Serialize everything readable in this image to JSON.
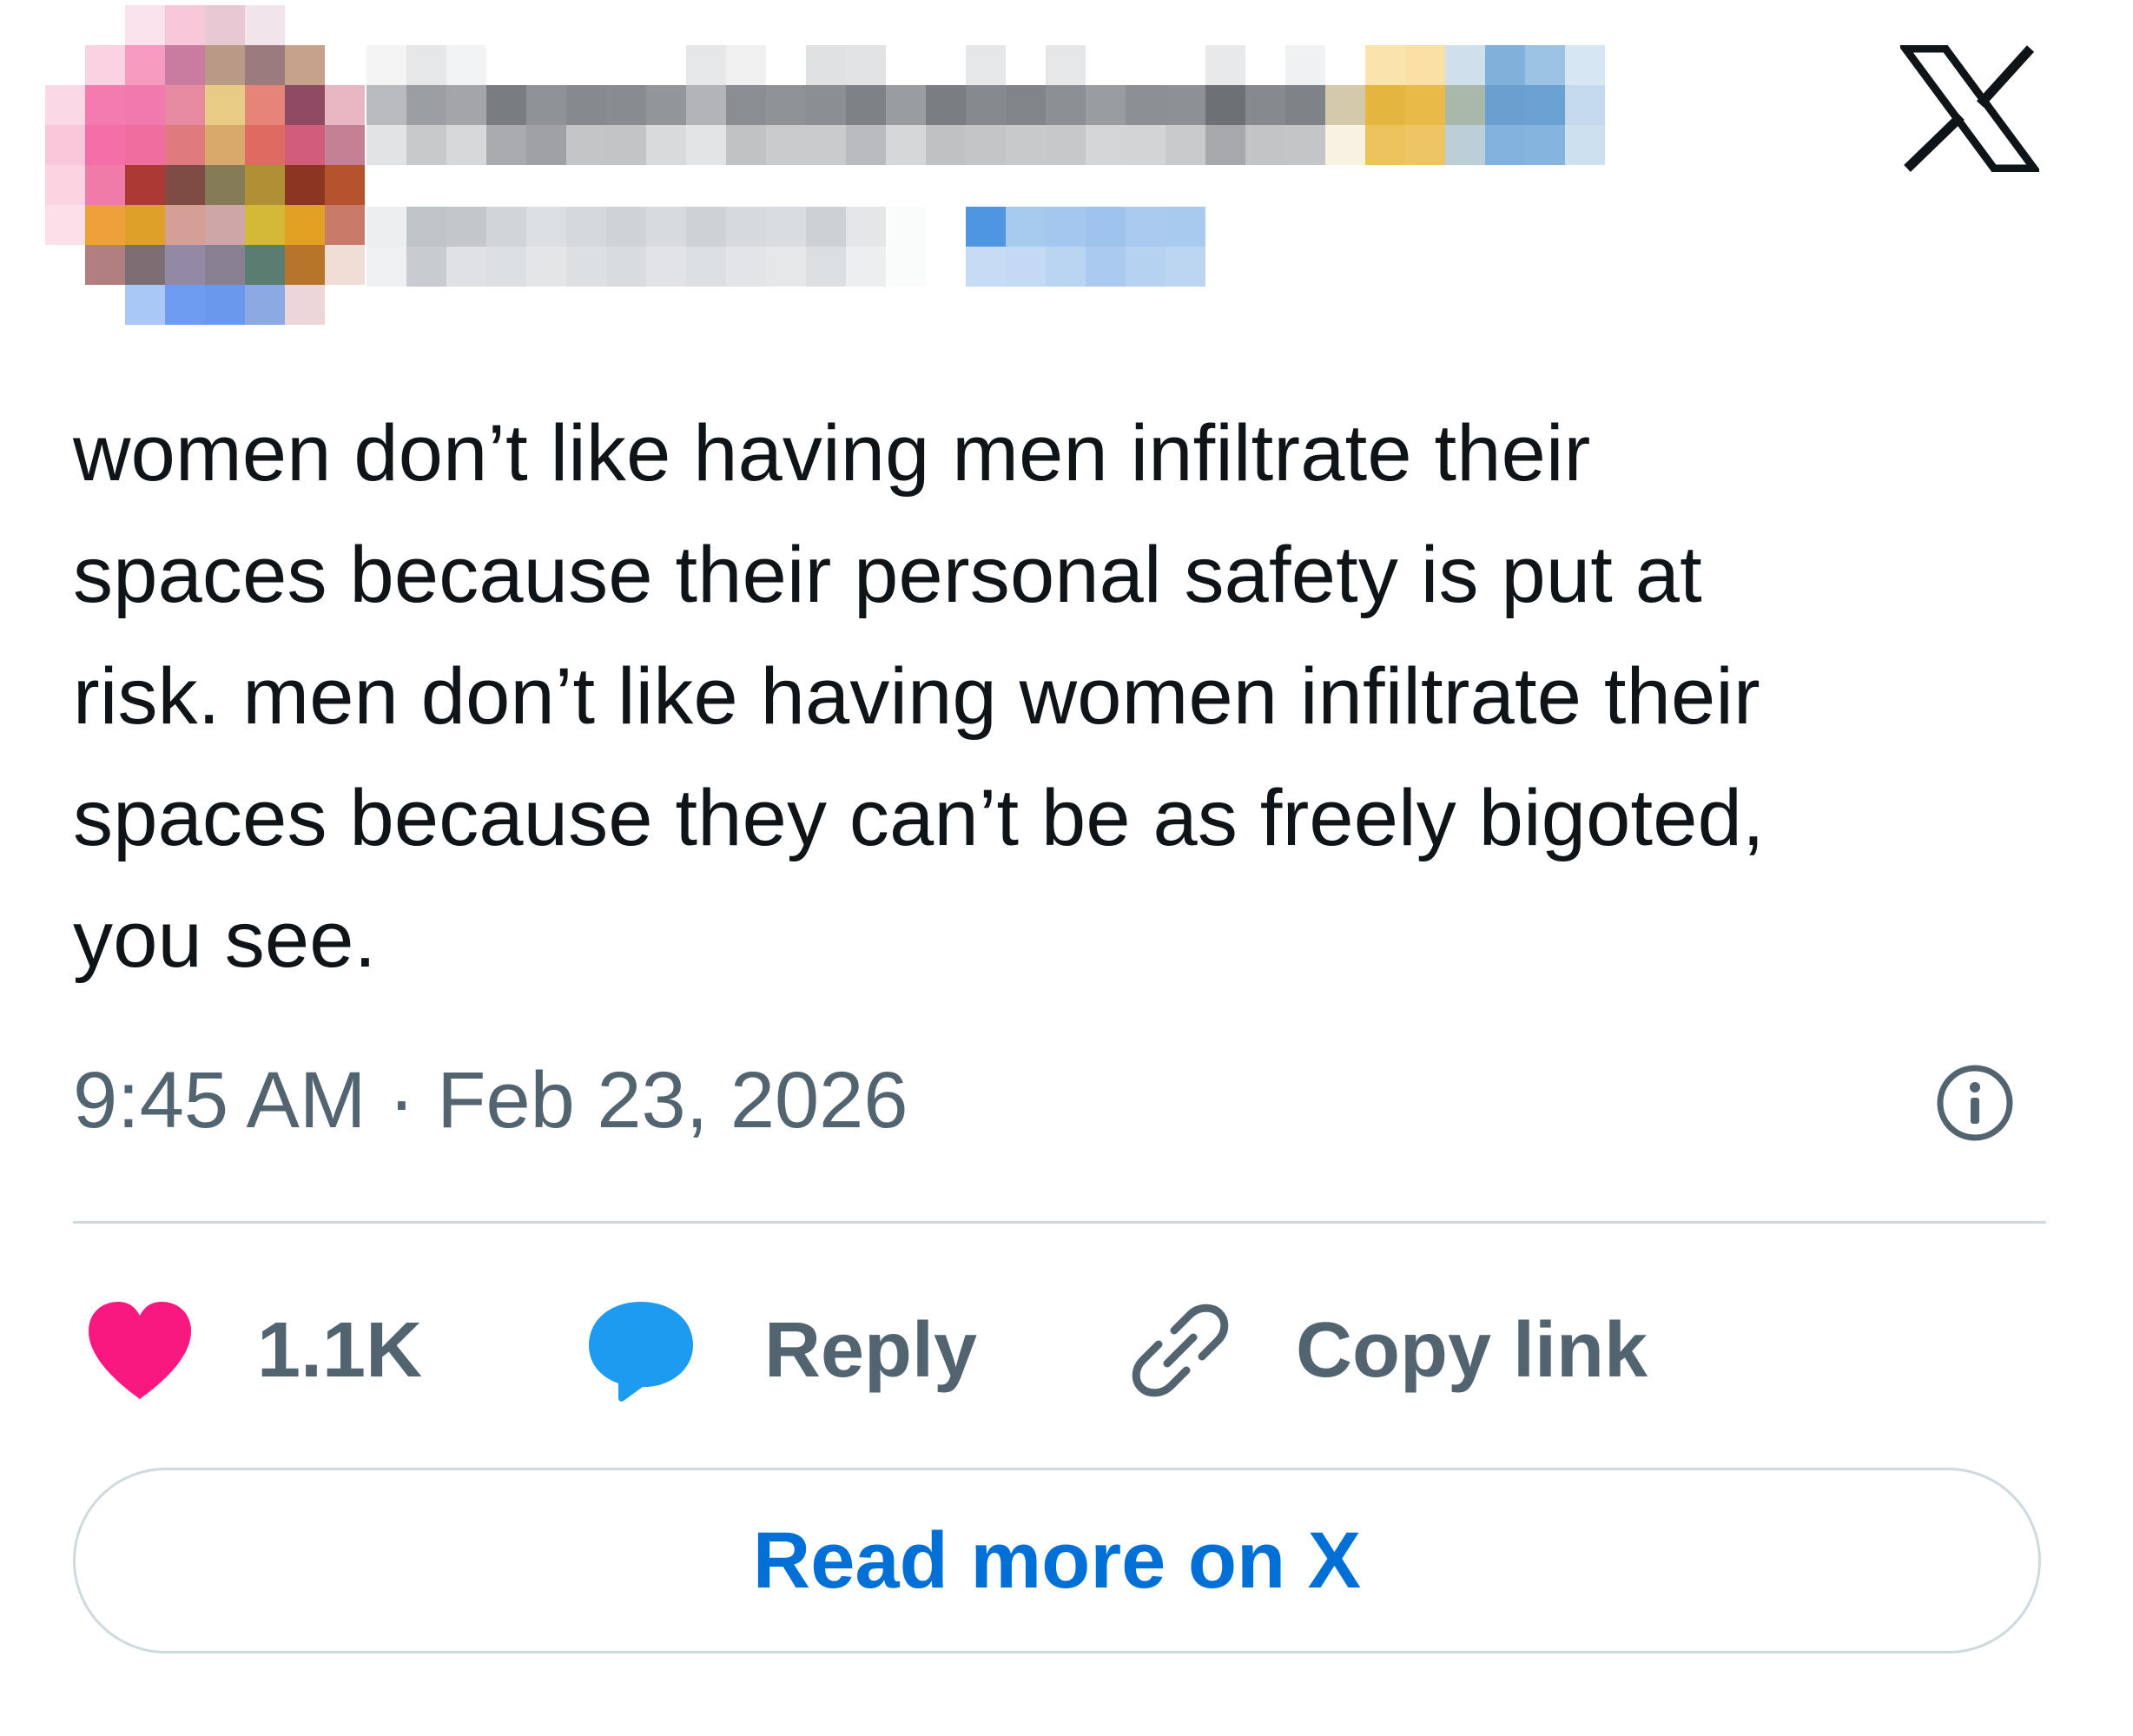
{
  "header": {
    "avatar_icon": "avatar-pixelated",
    "display_name": "",
    "handle": "",
    "brand_icon": "x-logo-icon"
  },
  "tweet": {
    "text_lines": [
      "women don’t like having men infiltrate their",
      "spaces because their personal safety is put at",
      "risk. men don’t like having women infiltrate their",
      "spaces because they can’t be as freely bigoted,",
      "you see."
    ],
    "timestamp": "9:45 AM · Feb 23, 2026",
    "info_icon": "info-icon"
  },
  "actions": {
    "like_icon": "heart-icon",
    "like_count": "1.1K",
    "reply_icon": "speech-bubble-icon",
    "reply_label": "Reply",
    "copy_icon": "link-icon",
    "copy_label": "Copy link"
  },
  "footer": {
    "read_more_label": "Read more on X"
  },
  "colors": {
    "text": "#0f1419",
    "secondary": "#536471",
    "divider": "#cfd9de",
    "like": "#f91880",
    "reply": "#1d9bf0",
    "link_blue": "#006fd6"
  }
}
